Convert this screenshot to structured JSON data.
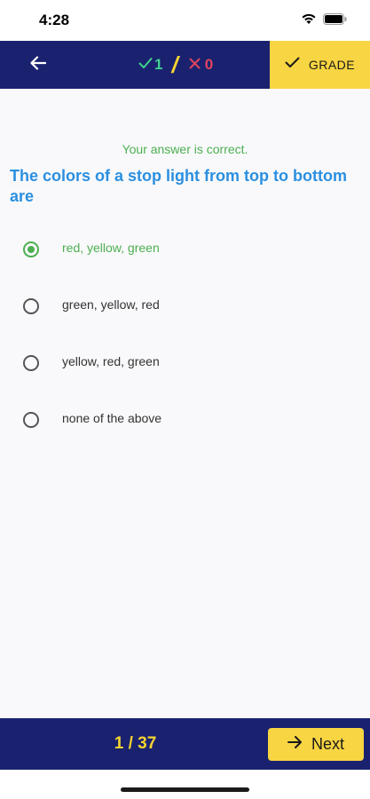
{
  "status_bar": {
    "time": "4:28"
  },
  "header": {
    "correct_count": "1",
    "separator": "/",
    "wrong_count": "0",
    "grade_label": "GRADE"
  },
  "quiz": {
    "feedback": "Your answer is correct.",
    "question": "The colors of a stop light from top to bottom are",
    "options": [
      {
        "label": "red, yellow, green",
        "selected": true
      },
      {
        "label": "green, yellow, red",
        "selected": false
      },
      {
        "label": "yellow, red, green",
        "selected": false
      },
      {
        "label": "none of the above",
        "selected": false
      }
    ]
  },
  "footer": {
    "page": "1 / 37",
    "next_label": "Next"
  },
  "colors": {
    "header_bg": "#1a2270",
    "accent_yellow": "#f8d542",
    "correct_green": "#4caf50",
    "question_blue": "#2b8fe0",
    "wrong_red": "#e0455b"
  }
}
